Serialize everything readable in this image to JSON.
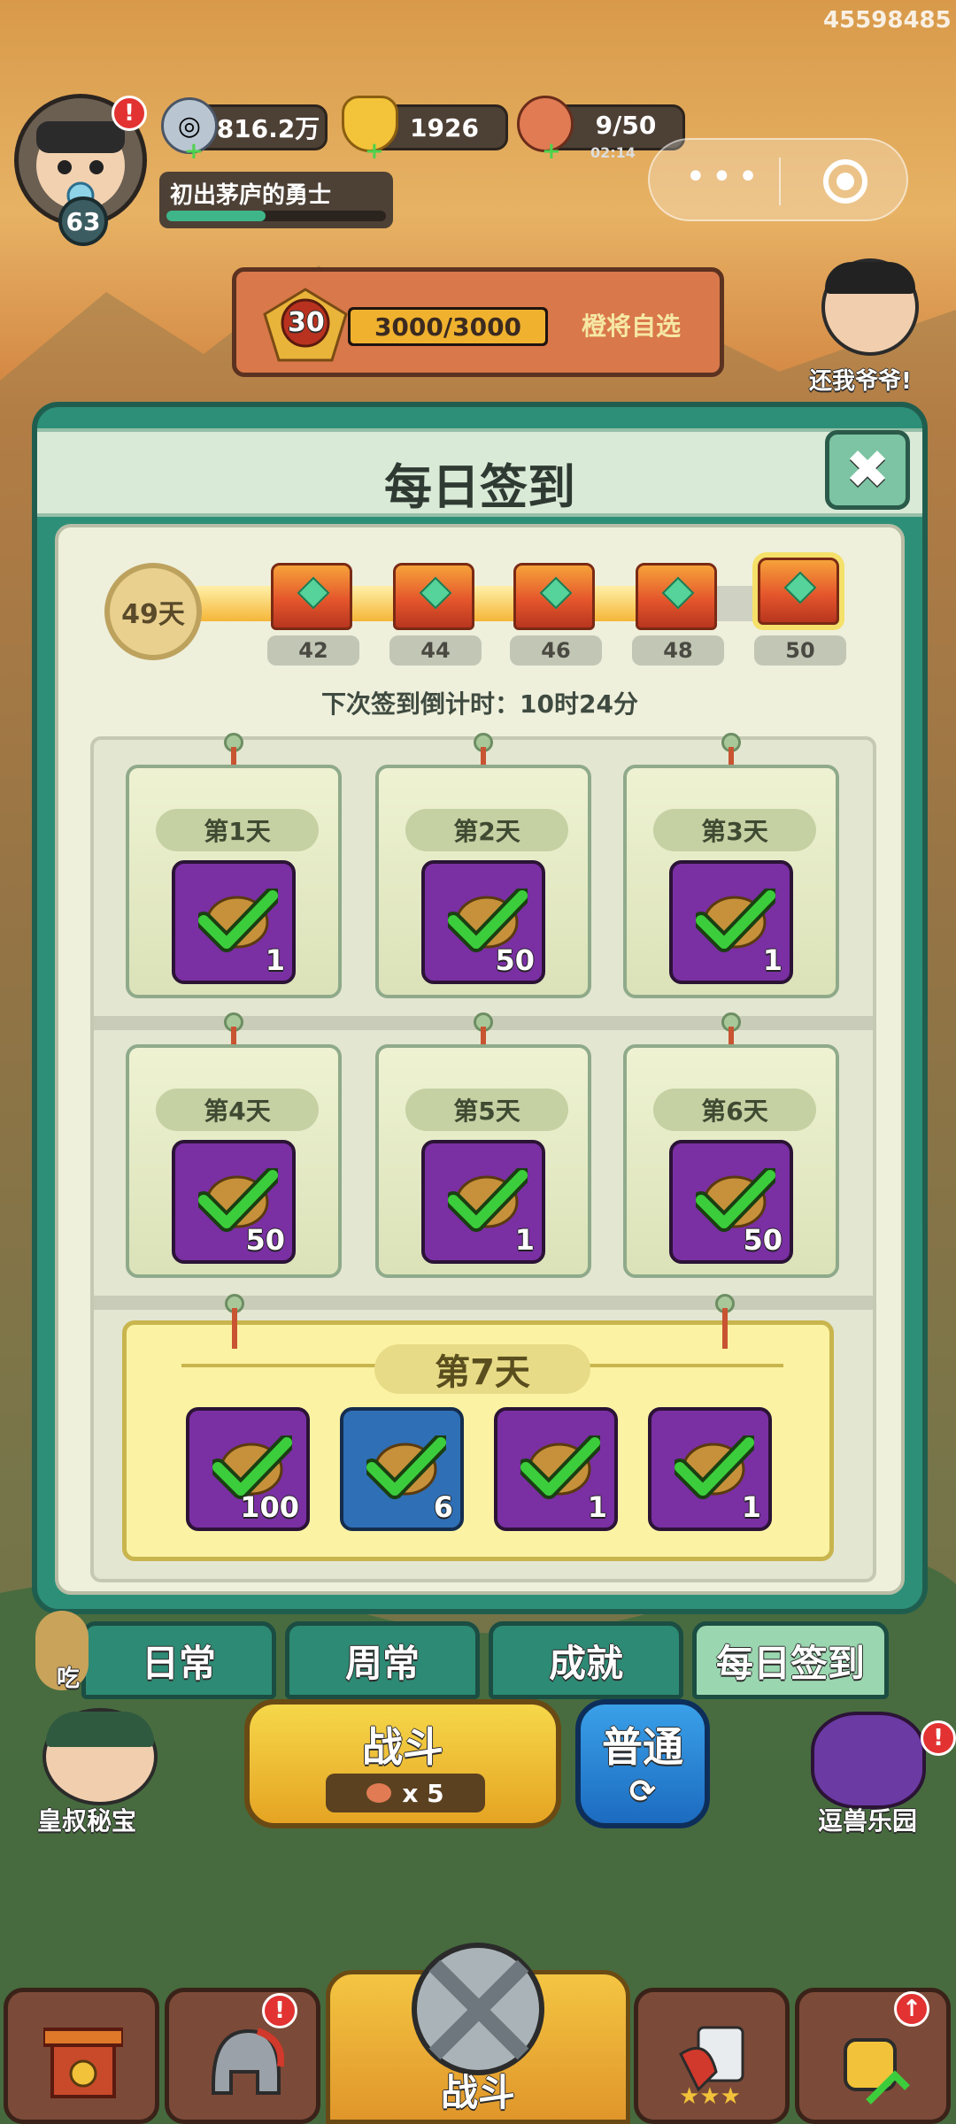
{
  "top": {
    "id_code": "45598485",
    "level": "63",
    "title": "初出茅庐的勇士",
    "silver": "816.2万",
    "gold": "1926",
    "stamina": "9/50",
    "stamina_timer": "02:14",
    "rank_level": "30",
    "rank_progress": "3000/3000",
    "rank_fill": 1.0,
    "rank_action": "橙将自选",
    "side_right_label": "还我爷爷!"
  },
  "dialog": {
    "title": "每日签到",
    "days_signed": "49天",
    "milestone_fill_fraction": 0.92,
    "milestones": [
      "42",
      "44",
      "46",
      "48",
      "50"
    ],
    "countdown": "下次签到倒计时：10时24分",
    "days": [
      {
        "label": "第1天",
        "count": "1"
      },
      {
        "label": "第2天",
        "count": "50"
      },
      {
        "label": "第3天",
        "count": "1"
      },
      {
        "label": "第4天",
        "count": "50"
      },
      {
        "label": "第5天",
        "count": "1"
      },
      {
        "label": "第6天",
        "count": "50"
      }
    ],
    "day7": {
      "label": "第7天",
      "rewards": [
        "100",
        "6",
        "1",
        "1"
      ]
    }
  },
  "tabs": [
    "日常",
    "周常",
    "成就",
    "每日签到"
  ],
  "lower": {
    "left_label": "皇叔秘宝",
    "right_label": "逗兽乐园",
    "battle_label": "战斗",
    "battle_cost": "x 5",
    "mode_label": "普通",
    "left_partial": "吃",
    "nav_battle": "战斗"
  },
  "colors": {
    "accent": "#2e8f78",
    "purple_tile": "#7a2fa3",
    "blue_tile": "#2f6fb6",
    "check": "#3ccd3c"
  }
}
